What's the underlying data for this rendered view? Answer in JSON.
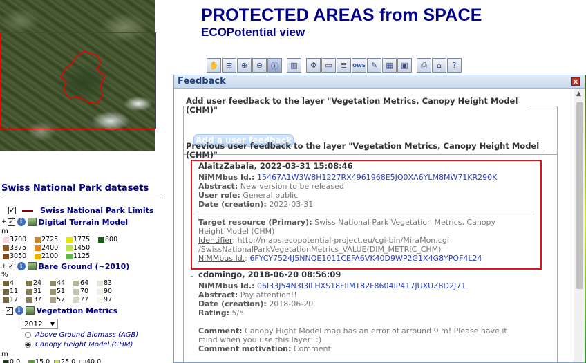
{
  "header": {
    "title": "PROTECTED AREAS from SPACE",
    "subtitle": "ECOPotential view"
  },
  "toolbar": {
    "icons": [
      "pan-hand-icon",
      "zoom-window-icon",
      "zoom-in-icon",
      "zoom-out-icon",
      "query-info-icon",
      "film-strip-icon",
      "settings-icon",
      "window-icon",
      "layers-icon",
      "ows-icon",
      "edit-icon",
      "calculator-icon",
      "monitor-icon",
      "print-icon",
      "home-icon",
      "help-icon"
    ]
  },
  "left_panel": {
    "title": "Swiss National Park datasets",
    "layers": [
      {
        "name": "Swiss National Park Limits",
        "checked": "✓"
      },
      {
        "name": "Digital Terrain Model",
        "checked": "✓",
        "expander": "+"
      },
      {
        "name": "Bare Ground (~2010)",
        "checked": "✓",
        "expander": "+"
      },
      {
        "name": "Vegetation Metrics",
        "checked": "✓",
        "expander": "–"
      }
    ],
    "dtm_unit": "m",
    "dtm_legend": [
      [
        {
          "v": "3700",
          "c": "#f5d7e6"
        },
        {
          "v": "2725",
          "c": "#c8862a"
        },
        {
          "v": "1775",
          "c": "#e6e600"
        },
        {
          "v": "800",
          "c": "#1a5c1a"
        }
      ],
      [
        {
          "v": "3375",
          "c": "#8a5a2b"
        },
        {
          "v": "2400",
          "c": "#e88a18"
        },
        {
          "v": "1450",
          "c": "#b8e64a"
        }
      ],
      [
        {
          "v": "3050",
          "c": "#7a4a1e"
        },
        {
          "v": "2100",
          "c": "#f0b000"
        },
        {
          "v": "1125",
          "c": "#5fb848"
        }
      ]
    ],
    "bare_unit": "%",
    "bare_legend": [
      [
        {
          "v": "4",
          "c": "#6e6440"
        },
        {
          "v": "24",
          "c": "#7f7752"
        },
        {
          "v": "44",
          "c": "#918a68"
        },
        {
          "v": "64",
          "c": "#b5b299"
        },
        {
          "v": "83",
          "c": "#e8e6da"
        }
      ],
      [
        {
          "v": "11",
          "c": "#6f6543"
        },
        {
          "v": "31",
          "c": "#847b57"
        },
        {
          "v": "51",
          "c": "#9b9474"
        },
        {
          "v": "70",
          "c": "#c5c2ad"
        },
        {
          "v": "90",
          "c": "#efeee6"
        }
      ],
      [
        {
          "v": "17",
          "c": "#726846"
        },
        {
          "v": "37",
          "c": "#88805d"
        },
        {
          "v": "57",
          "c": "#a8a286"
        },
        {
          "v": "77",
          "c": "#d7d5c8"
        },
        {
          "v": "97",
          "c": "#f6f6f1"
        }
      ]
    ],
    "year_select": "2012",
    "radios": [
      {
        "label": "Above Ground Biomass (AGB)",
        "selected": false
      },
      {
        "label": "Canopy Height Model (CHM)",
        "selected": true
      }
    ],
    "chm_unit": "m",
    "chm_legend": [
      {
        "v": "0.0",
        "c": "#1e3b14"
      },
      {
        "v": "15.0",
        "c": "#5f9e28"
      },
      {
        "v": "25.0",
        "c": "#c8e64a"
      },
      {
        "v": "40.0",
        "c": "#f2f2f2"
      }
    ]
  },
  "feedback": {
    "window_title": "Feedback",
    "close_label": "x",
    "add_section_legend": "Add user feedback to the layer \"Vegetation Metrics, Canopy Height Model (CHM)\"",
    "add_button": "Add a user feedback",
    "prev_section_legend": "Previous user feedback to the layer \"Vegetation Metrics, Canopy Height Model (CHM)\"",
    "entries": [
      {
        "header": "AlaitzZabala, 2022-03-31 15:08:46",
        "id_label": "NiMMbus Id.:",
        "id_value": "15467A1W3W8H1227RX4961968E5JQ0XA6YLM8MW71KR290K",
        "abstract_label": "Abstract:",
        "abstract_value": "New version to be released",
        "role_label": "User role:",
        "role_value": "General public",
        "date_label": "Date (creation):",
        "date_value": "2022-03-31",
        "target_label": "Target resource (Primary):",
        "target_value_1": "Swiss National Park Vegetation Metrics, Canopy",
        "target_value_2": "Height Model (CHM)",
        "identifier_label": "Identifier",
        "identifier_value_1": ": http://maps.ecopotential-project.eu/cgi-bin/MiraMon.cgi",
        "identifier_value_2": "/SwissNationalParkVegetationMetrics_VALUE(DIM_METRIC_CHM)",
        "nimmbus_label": "NiMMbus Id.",
        "nimmbus_value": "6FYCY7524J5NNQE1011CEFA6VK40D9WP2G1X4G8YPOF4L24"
      },
      {
        "header": "cdomingo, 2018-06-20 08:56:09",
        "id_label": "NiMMbus Id.:",
        "id_value": "06I33J54N3I3ILHXS18FIIMT82F8604IP417JUXUZ8D2J71",
        "abstract_label": "Abstract:",
        "abstract_value": "Pay attention!!",
        "date_label": "Date (creation):",
        "date_value": "2018-06-20",
        "rating_label": "Rating:",
        "rating_value": "5/5",
        "comment_label": "Comment:",
        "comment_value_1": "Canopy Hight Model map has an error of arround 9 m! Please have it",
        "comment_value_2": "mind when you use this layer! :)",
        "motivation_label": "Comment motivation:",
        "motivation_value": "Comment"
      }
    ]
  }
}
